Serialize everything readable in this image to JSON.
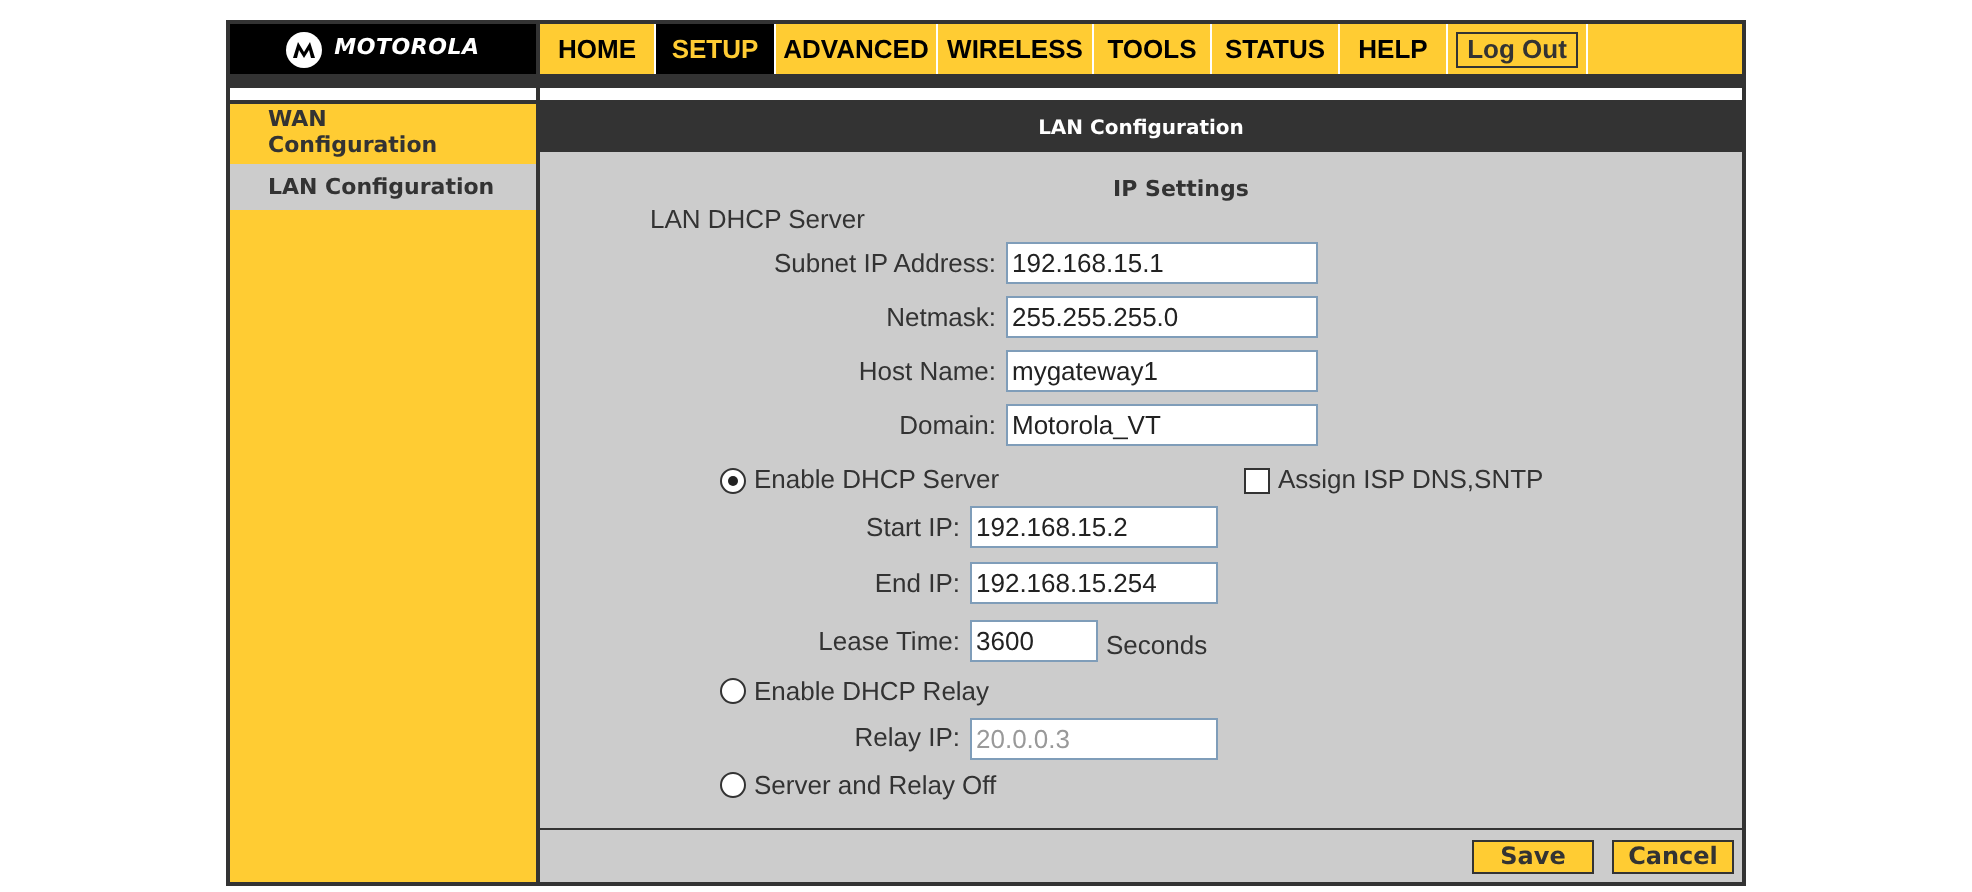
{
  "logo": {
    "text": "MOTOROLA"
  },
  "nav": [
    {
      "label": "HOME",
      "selected": false
    },
    {
      "label": "SETUP",
      "selected": true
    },
    {
      "label": "ADVANCED",
      "selected": false
    },
    {
      "label": "WIRELESS",
      "selected": false
    },
    {
      "label": "TOOLS",
      "selected": false
    },
    {
      "label": "STATUS",
      "selected": false
    },
    {
      "label": "HELP",
      "selected": false
    }
  ],
  "logout": "Log Out",
  "sidebar": {
    "items": [
      {
        "label": "WAN Configuration",
        "selected": false
      },
      {
        "label": "LAN Configuration",
        "selected": true
      }
    ]
  },
  "panel": {
    "title": "LAN Configuration",
    "section": "IP Settings",
    "group": "LAN DHCP Server",
    "fields": [
      {
        "label": "Subnet IP Address:",
        "value": "192.168.15.1"
      },
      {
        "label": "Netmask:",
        "value": "255.255.255.0"
      },
      {
        "label": "Host Name:",
        "value": "mygateway1"
      },
      {
        "label": "Domain:",
        "value": "Motorola_VT"
      }
    ],
    "modes": [
      {
        "label": "Enable DHCP Server",
        "selected": true,
        "fields": [
          {
            "label": "Start IP:",
            "value": "192.168.15.2",
            "disabled": false
          },
          {
            "label": "End IP:",
            "value": "192.168.15.254",
            "disabled": false
          },
          {
            "label": "Lease Time:",
            "value": "3600",
            "disabled": false,
            "unit": "Seconds"
          }
        ]
      },
      {
        "label": "Enable DHCP Relay",
        "selected": false,
        "fields": [
          {
            "label": "Relay IP:",
            "value": "20.0.0.3",
            "disabled": true
          }
        ]
      },
      {
        "label": "Server and Relay Off",
        "selected": false
      }
    ],
    "assign_dns": {
      "label": "Assign ISP DNS,SNTP",
      "checked": false
    }
  },
  "buttons": [
    "Save",
    "Cancel"
  ]
}
